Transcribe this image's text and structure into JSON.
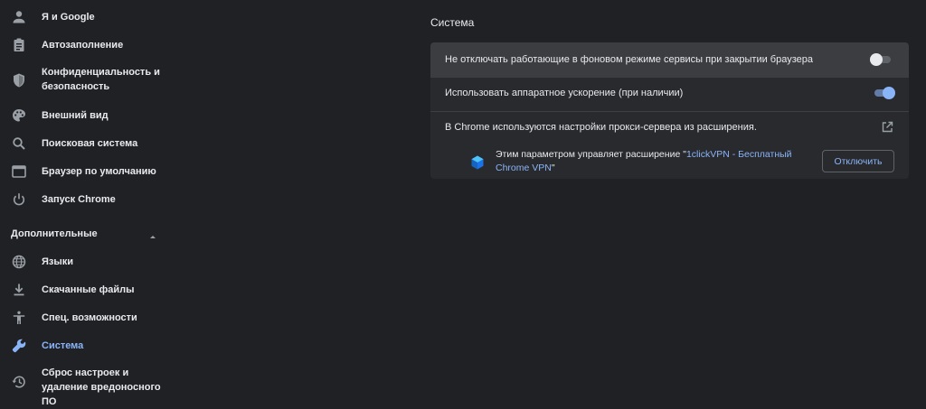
{
  "sidebar": {
    "items": [
      {
        "label": "Я и Google",
        "icon": "person-icon"
      },
      {
        "label": "Автозаполнение",
        "icon": "clipboard-icon"
      },
      {
        "label": "Конфиденциальность и безопасность",
        "icon": "shield-icon"
      },
      {
        "label": "Внешний вид",
        "icon": "palette-icon"
      },
      {
        "label": "Поисковая система",
        "icon": "search-icon"
      },
      {
        "label": "Браузер по умолчанию",
        "icon": "browser-icon"
      },
      {
        "label": "Запуск Chrome",
        "icon": "power-icon"
      }
    ],
    "advanced_label": "Дополнительные",
    "advanced_items": [
      {
        "label": "Языки",
        "icon": "globe-icon"
      },
      {
        "label": "Скачанные файлы",
        "icon": "download-icon"
      },
      {
        "label": "Спец. возможности",
        "icon": "accessibility-icon"
      },
      {
        "label": "Система",
        "icon": "wrench-icon",
        "selected": true
      },
      {
        "label": "Сброс настроек и удаление вредоносного ПО",
        "icon": "restore-icon"
      }
    ]
  },
  "main": {
    "title": "Система",
    "settings": [
      {
        "label": "Не отключать работающие в фоновом режиме сервисы при закрытии браузера",
        "enabled": false
      },
      {
        "label": "Использовать аппаратное ускорение (при наличии)",
        "enabled": true
      }
    ],
    "proxy": {
      "label": "В Chrome используются настройки прокси-сервера из расширения.",
      "icon": "open-in-new-icon",
      "managed_prefix": "Этим параметром управляет расширение \"",
      "extension_name": "1clickVPN - Бесплатный Chrome VPN",
      "managed_suffix": "\"",
      "extension_icon": "vpn-extension-icon",
      "disable_button": "Отключить"
    }
  },
  "colors": {
    "background": "#202124",
    "card": "#292a2d",
    "accent": "#8ab4f8",
    "text": "#e8eaed"
  }
}
